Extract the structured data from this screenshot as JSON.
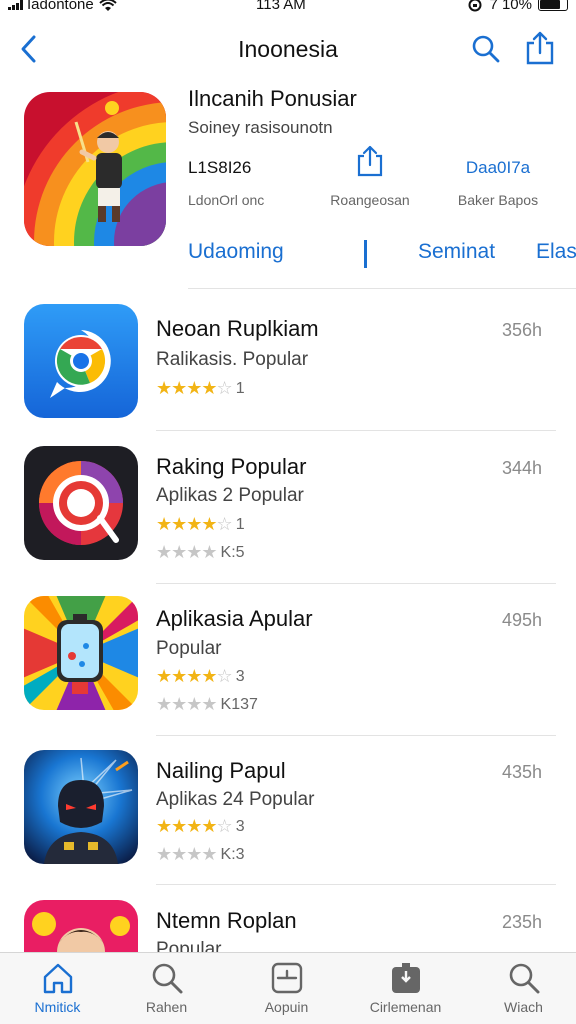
{
  "status_bar": {
    "carrier": "Iadontone",
    "time": "113 AM",
    "battery": "7 10%"
  },
  "nav": {
    "title": "Inoonesia"
  },
  "featured": {
    "title": "Ilncanih Ponusiar",
    "subtitle": "Soiney rasisounotn",
    "stats": [
      {
        "value": "L1S8I26",
        "label": "LdonOrl onc"
      },
      {
        "value": "",
        "label": "Roangeosan"
      },
      {
        "value": "Daa0I7a",
        "label": "Baker Bapos"
      }
    ],
    "actions": [
      "Udaoming",
      "Seminat",
      "Elas"
    ]
  },
  "list": [
    {
      "name": "Neoan Ruplkiam",
      "subtitle": "Ralikasis. Popular",
      "size": "356h",
      "rating": 4.5,
      "rating_count": "1"
    },
    {
      "name": "Raking Popular",
      "subtitle": "Aplikas 2 Popular",
      "size": "344h",
      "rating": 4.5,
      "rating_count": "1",
      "rating2": 0,
      "rating2_count": "K:5"
    },
    {
      "name": "Aplikasia Apular",
      "subtitle": "Popular",
      "size": "495h",
      "rating": 4.5,
      "rating_count": "3",
      "rating2": 0,
      "rating2_count": "K137"
    },
    {
      "name": "Nailing Papul",
      "subtitle": "Aplikas 24 Popular",
      "size": "435h",
      "rating": 4.5,
      "rating_count": "3",
      "rating2": 0,
      "rating2_count": "K:3"
    },
    {
      "name": "Ntemn Roplan",
      "subtitle": "Popular",
      "size": "235h"
    }
  ],
  "tabs": [
    {
      "label": "Nmitick",
      "icon": "home-icon",
      "active": true
    },
    {
      "label": "Rahen",
      "icon": "search-icon",
      "active": false
    },
    {
      "label": "Aopuin",
      "icon": "apps-icon",
      "active": false
    },
    {
      "label": "Cirlemenan",
      "icon": "updates-icon",
      "active": false
    },
    {
      "label": "Wiach",
      "icon": "search-icon",
      "active": false
    }
  ],
  "colors": {
    "accent": "#1a6fd1",
    "star": "#f2b415",
    "star_empty": "#c6c6c6"
  }
}
